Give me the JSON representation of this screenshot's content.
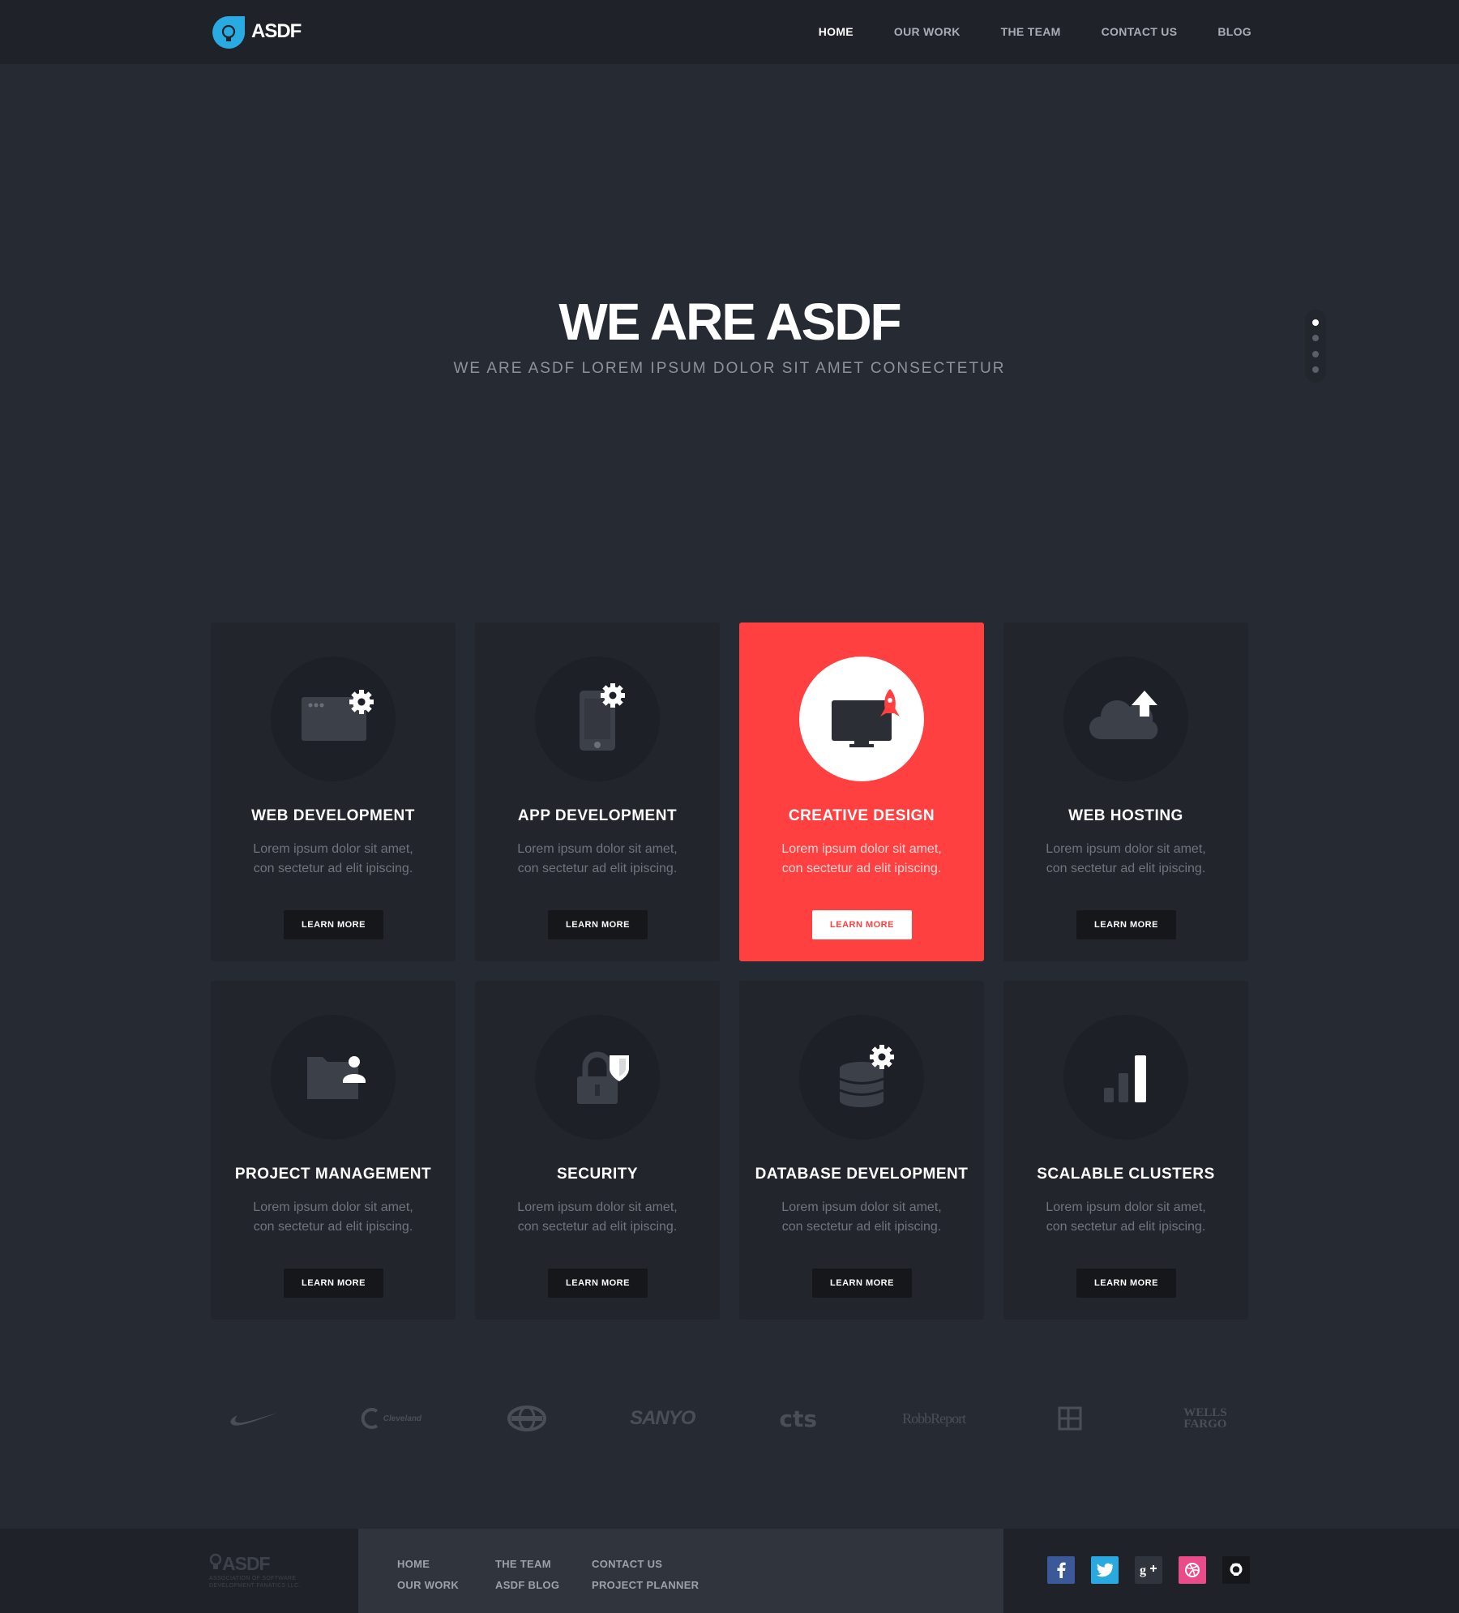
{
  "brand": {
    "name": "ASDF",
    "accent": "#29abe2"
  },
  "nav": [
    "HOME",
    "OUR WORK",
    "THE TEAM",
    "CONTACT US",
    "BLOG"
  ],
  "hero": {
    "title": "WE ARE ASDF",
    "subtitle": "WE ARE ASDF LOREM IPSUM DOLOR SIT AMET CONSECTETUR"
  },
  "slider": {
    "count": 4,
    "active": 1
  },
  "services": [
    {
      "title": "WEB DEVELOPMENT",
      "line1": "Lorem ipsum dolor sit amet,",
      "line2": "con sectetur ad elit ipiscing.",
      "button": "LEARN MORE",
      "icon": "browser-gear-icon"
    },
    {
      "title": "APP DEVELOPMENT",
      "line1": "Lorem ipsum dolor sit amet,",
      "line2": "con sectetur ad elit ipiscing.",
      "button": "LEARN MORE",
      "icon": "phone-gear-icon"
    },
    {
      "title": "CREATIVE DESIGN",
      "line1": "Lorem ipsum dolor sit amet,",
      "line2": "con sectetur ad elit ipiscing.",
      "button": "LEARN MORE",
      "icon": "monitor-rocket-icon"
    },
    {
      "title": "WEB HOSTING",
      "line1": "Lorem ipsum dolor sit amet,",
      "line2": "con sectetur ad elit ipiscing.",
      "button": "LEARN MORE",
      "icon": "cloud-upload-icon"
    },
    {
      "title": "PROJECT MANAGEMENT",
      "line1": "Lorem ipsum dolor sit amet,",
      "line2": "con sectetur ad elit ipiscing.",
      "button": "LEARN MORE",
      "icon": "folder-user-icon"
    },
    {
      "title": "SECURITY",
      "line1": "Lorem ipsum dolor sit amet,",
      "line2": "con sectetur ad elit ipiscing.",
      "button": "LEARN MORE",
      "icon": "lock-shield-icon"
    },
    {
      "title": "DATABASE DEVELOPMENT",
      "line1": "Lorem ipsum dolor sit amet,",
      "line2": "con sectetur ad elit ipiscing.",
      "button": "LEARN MORE",
      "icon": "database-gear-icon"
    },
    {
      "title": "SCALABLE CLUSTERS",
      "line1": "Lorem ipsum dolor sit amet,",
      "line2": "con sectetur ad elit ipiscing.",
      "button": "LEARN MORE",
      "icon": "signal-bars-icon"
    }
  ],
  "clients": {
    "cleveland": "Cleveland",
    "sanyo": "SANYO",
    "cts": "cts",
    "robb": "RobbReport",
    "wells1": "WELLS",
    "wells2": "FARGO"
  },
  "footer": {
    "logo": "ASDF",
    "tagline": "ASSOCIATION OF SOFTWARE DEVELOPMENT FANATICS LLC.",
    "col1": [
      "HOME",
      "OUR WORK"
    ],
    "col2": [
      "THE TEAM",
      "ASDF BLOG"
    ],
    "col3": [
      "CONTACT US",
      "PROJECT PLANNER"
    ],
    "social": [
      {
        "icon": "facebook-icon",
        "color": "#3b5998"
      },
      {
        "icon": "twitter-icon",
        "color": "#2aa9e0"
      },
      {
        "icon": "google-plus-icon",
        "color": "#30343d"
      },
      {
        "icon": "dribbble-icon",
        "color": "#ea4c89"
      },
      {
        "icon": "github-icon",
        "color": "#15171b"
      }
    ]
  }
}
